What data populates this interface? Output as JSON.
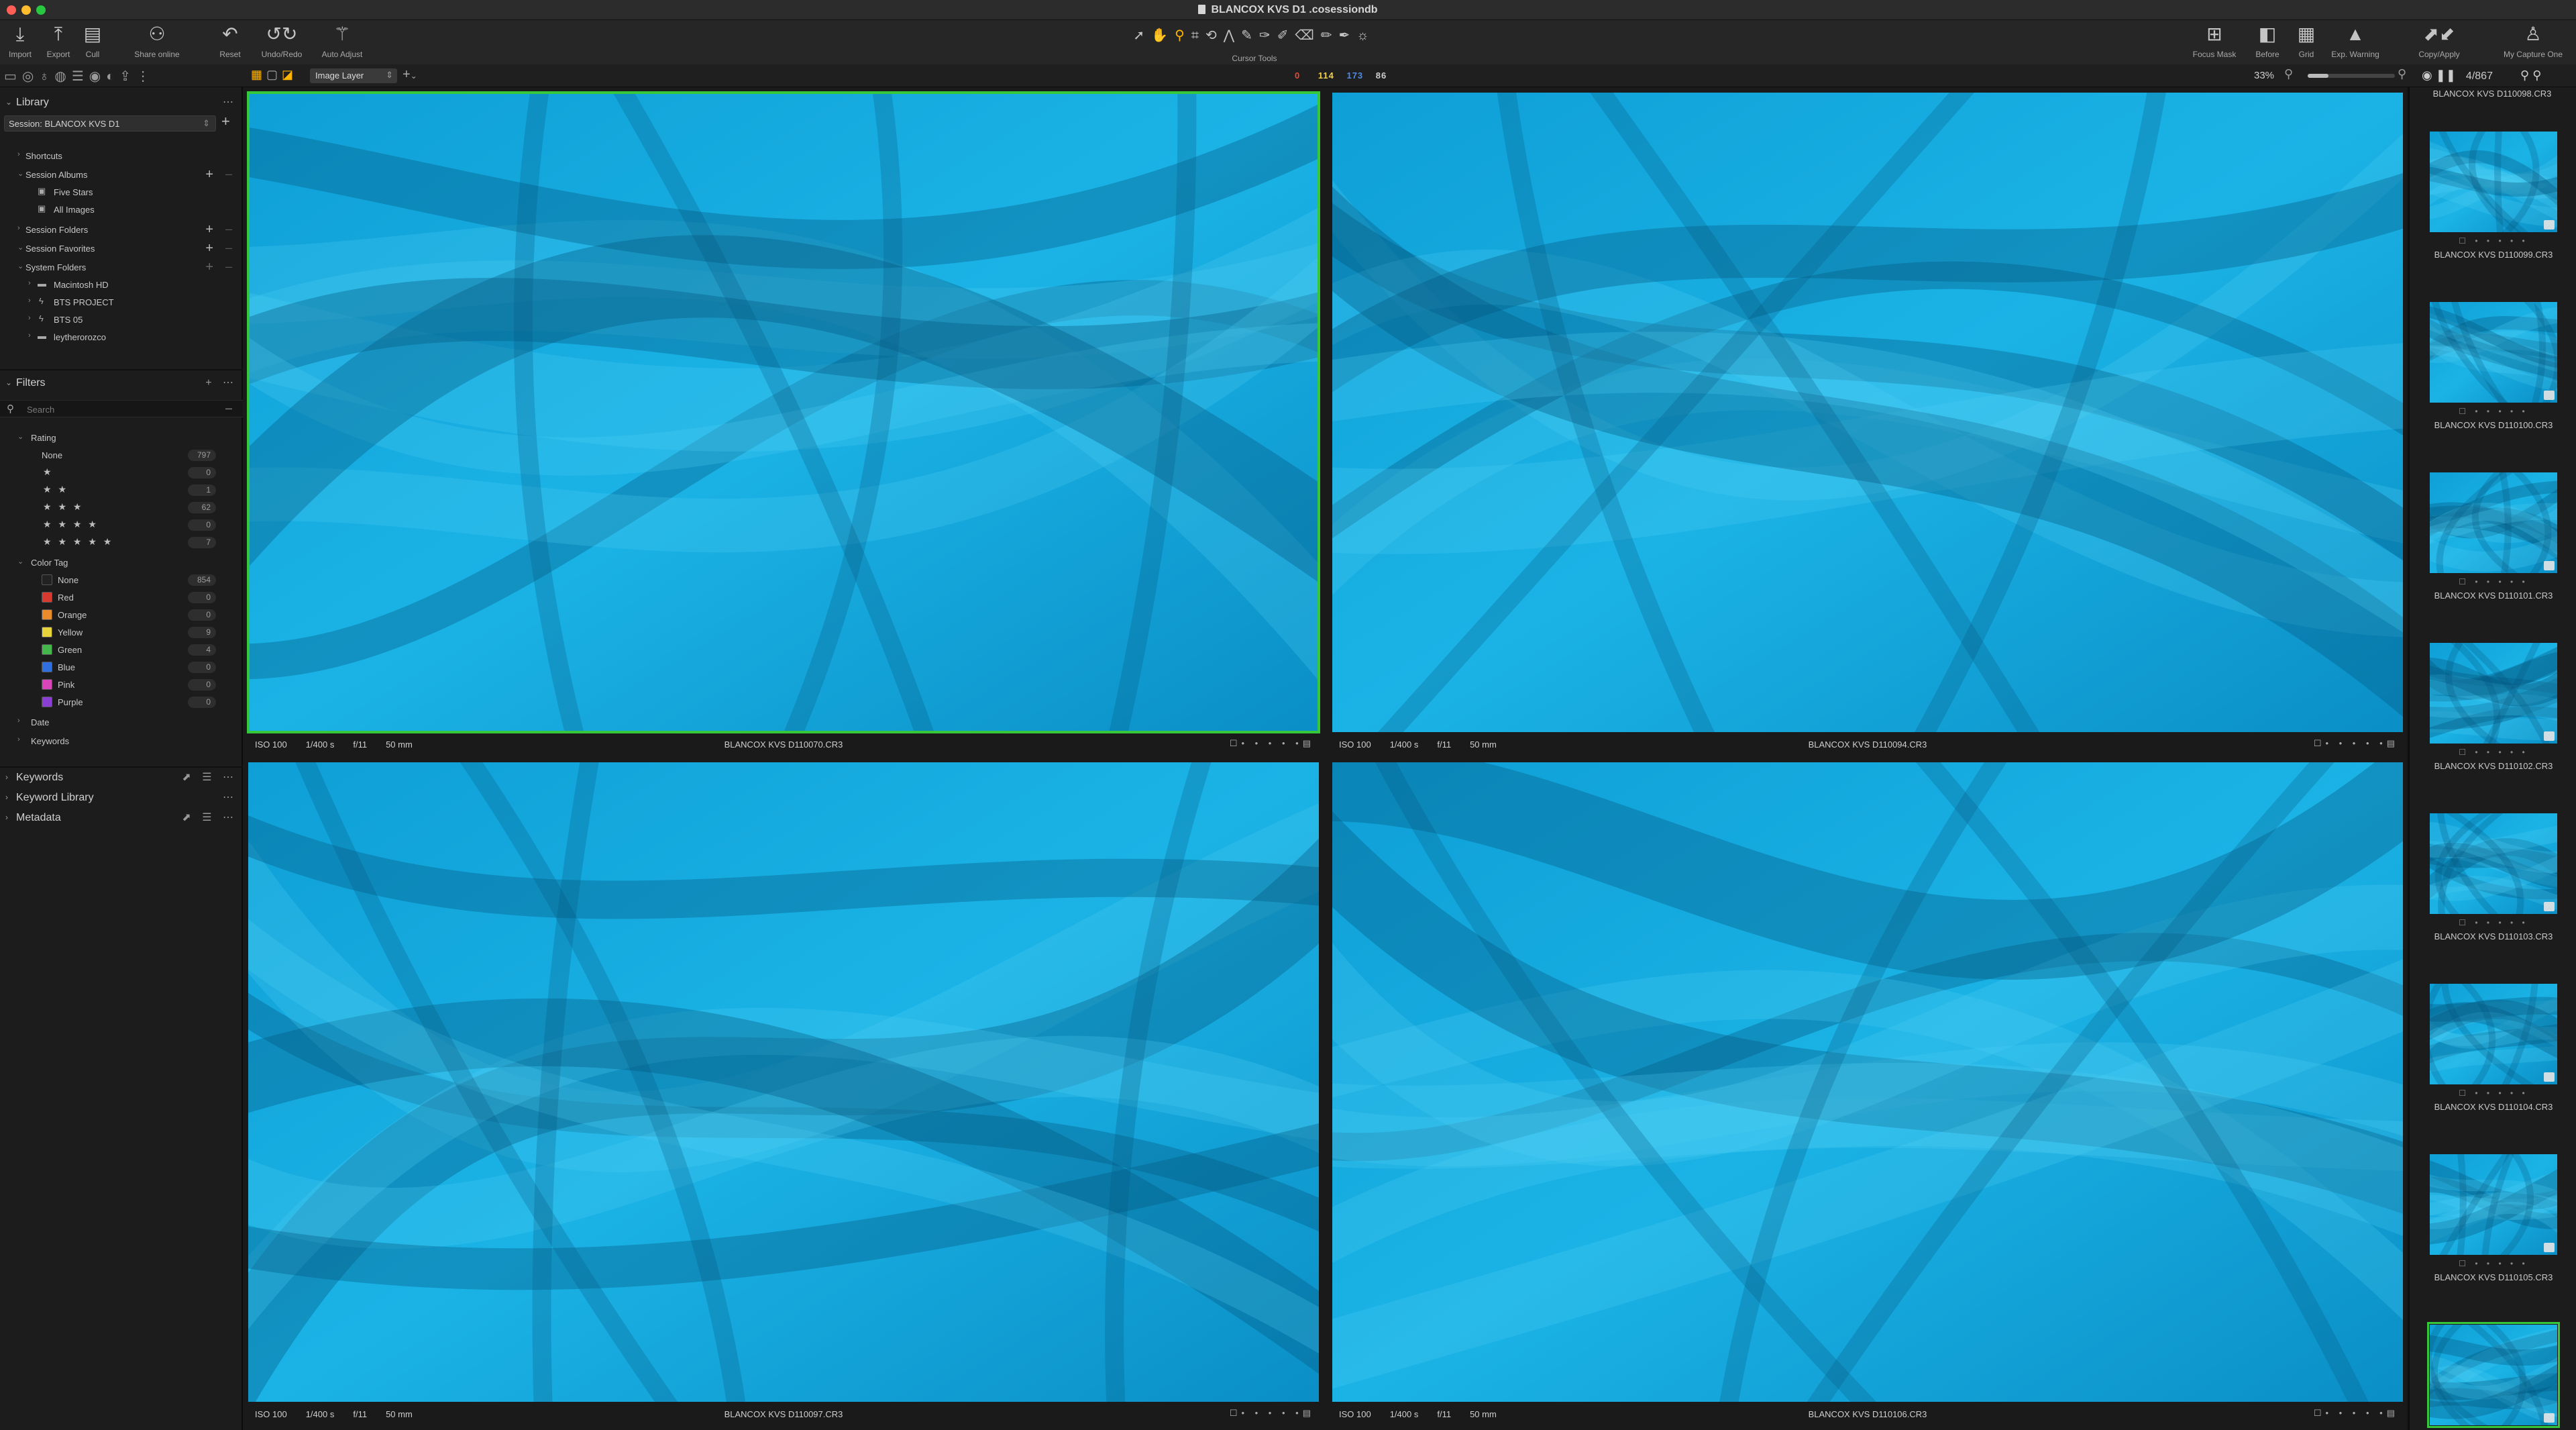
{
  "window": {
    "title": "BLANCOX KVS D1 .cosessiondb"
  },
  "toolbar": {
    "left": [
      {
        "name": "import",
        "label": "Import",
        "icon": "import-icon"
      },
      {
        "name": "export",
        "label": "Export",
        "icon": "export-icon"
      },
      {
        "name": "cull",
        "label": "Cull",
        "icon": "cull-icon"
      },
      {
        "name": "share",
        "label": "Share online",
        "icon": "share-icon"
      },
      {
        "name": "reset",
        "label": "Reset",
        "icon": "reset-icon"
      },
      {
        "name": "undoredo",
        "label": "Undo/Redo",
        "icon": "undo-icon"
      },
      {
        "name": "autoadjust",
        "label": "Auto Adjust",
        "icon": "wand-icon"
      }
    ],
    "cursor_tools_label": "Cursor Tools",
    "right": [
      {
        "name": "focus-mask",
        "label": "Focus Mask",
        "icon": "focus-mask-icon"
      },
      {
        "name": "before",
        "label": "Before",
        "icon": "before-icon"
      },
      {
        "name": "grid",
        "label": "Grid",
        "icon": "grid-icon"
      },
      {
        "name": "exp-warning",
        "label": "Exp. Warning",
        "icon": "warning-icon"
      },
      {
        "name": "copy-apply",
        "label": "Copy/Apply",
        "icon": "copy-apply-icon"
      },
      {
        "name": "my-capture-one",
        "label": "My Capture One",
        "icon": "user-icon"
      }
    ]
  },
  "strip": {
    "layer": "Image Layer",
    "counts": {
      "red": "0",
      "green": "114",
      "blue": "173",
      "gray": "86"
    },
    "zoom": "33%",
    "zoom_fraction": 0.24,
    "position": "4/867"
  },
  "library": {
    "title": "Library",
    "session": "Session: BLANCOX KVS D1",
    "shortcuts": "Shortcuts",
    "session_albums": "Session Albums",
    "albums": [
      "Five Stars",
      "All Images"
    ],
    "session_folders": "Session Folders",
    "session_favorites": "Session Favorites",
    "system_folders": "System Folders",
    "folders": [
      "Macintosh HD",
      "BTS PROJECT",
      "BTS 05",
      "leytherorozco"
    ]
  },
  "filters": {
    "title": "Filters",
    "search_placeholder": "Search",
    "rating_label": "Rating",
    "ratings": [
      {
        "label": "None",
        "stars": "",
        "count": "797"
      },
      {
        "label": "",
        "stars": "★",
        "count": "0"
      },
      {
        "label": "",
        "stars": "★ ★",
        "count": "1"
      },
      {
        "label": "",
        "stars": "★ ★ ★",
        "count": "62"
      },
      {
        "label": "",
        "stars": "★ ★ ★ ★",
        "count": "0"
      },
      {
        "label": "",
        "stars": "★ ★ ★ ★ ★",
        "count": "7"
      }
    ],
    "color_tag_label": "Color Tag",
    "color_tags": [
      {
        "label": "None",
        "color": "#222222",
        "count": "854"
      },
      {
        "label": "Red",
        "color": "#d83a30",
        "count": "0"
      },
      {
        "label": "Orange",
        "color": "#e98a2c",
        "count": "0"
      },
      {
        "label": "Yellow",
        "color": "#e7d33a",
        "count": "9"
      },
      {
        "label": "Green",
        "color": "#45b649",
        "count": "4"
      },
      {
        "label": "Blue",
        "color": "#2f6fe0",
        "count": "0"
      },
      {
        "label": "Pink",
        "color": "#d845b9",
        "count": "0"
      },
      {
        "label": "Purple",
        "color": "#8a3ed3",
        "count": "0"
      }
    ],
    "date_label": "Date",
    "keywords_label": "Keywords"
  },
  "tools": {
    "keywords": "Keywords",
    "keyword_library": "Keyword Library",
    "metadata": "Metadata"
  },
  "viewer": {
    "tiles": [
      {
        "iso": "ISO 100",
        "shutter": "1/400 s",
        "aperture": "f/11",
        "focal": "50 mm",
        "name": "BLANCOX KVS D110070.CR3",
        "selected": true
      },
      {
        "iso": "ISO 100",
        "shutter": "1/400 s",
        "aperture": "f/11",
        "focal": "50 mm",
        "name": "BLANCOX KVS D110094.CR3",
        "selected": false
      },
      {
        "iso": "ISO 100",
        "shutter": "1/400 s",
        "aperture": "f/11",
        "focal": "50 mm",
        "name": "BLANCOX KVS D110097.CR3",
        "selected": false
      },
      {
        "iso": "ISO 100",
        "shutter": "1/400 s",
        "aperture": "f/11",
        "focal": "50 mm",
        "name": "BLANCOX KVS D110106.CR3",
        "selected": false
      }
    ]
  },
  "browser": {
    "top_name": "BLANCOX KVS D110098.CR3",
    "thumbs": [
      "BLANCOX KVS D110099.CR3",
      "BLANCOX KVS D110100.CR3",
      "BLANCOX KVS D110101.CR3",
      "BLANCOX KVS D110102.CR3",
      "BLANCOX KVS D110103.CR3",
      "BLANCOX KVS D110104.CR3",
      "BLANCOX KVS D110105.CR3",
      ""
    ]
  },
  "colors": {
    "accent": "#ffb400",
    "selection": "#36c83a",
    "fabric": "#12a8dc"
  }
}
